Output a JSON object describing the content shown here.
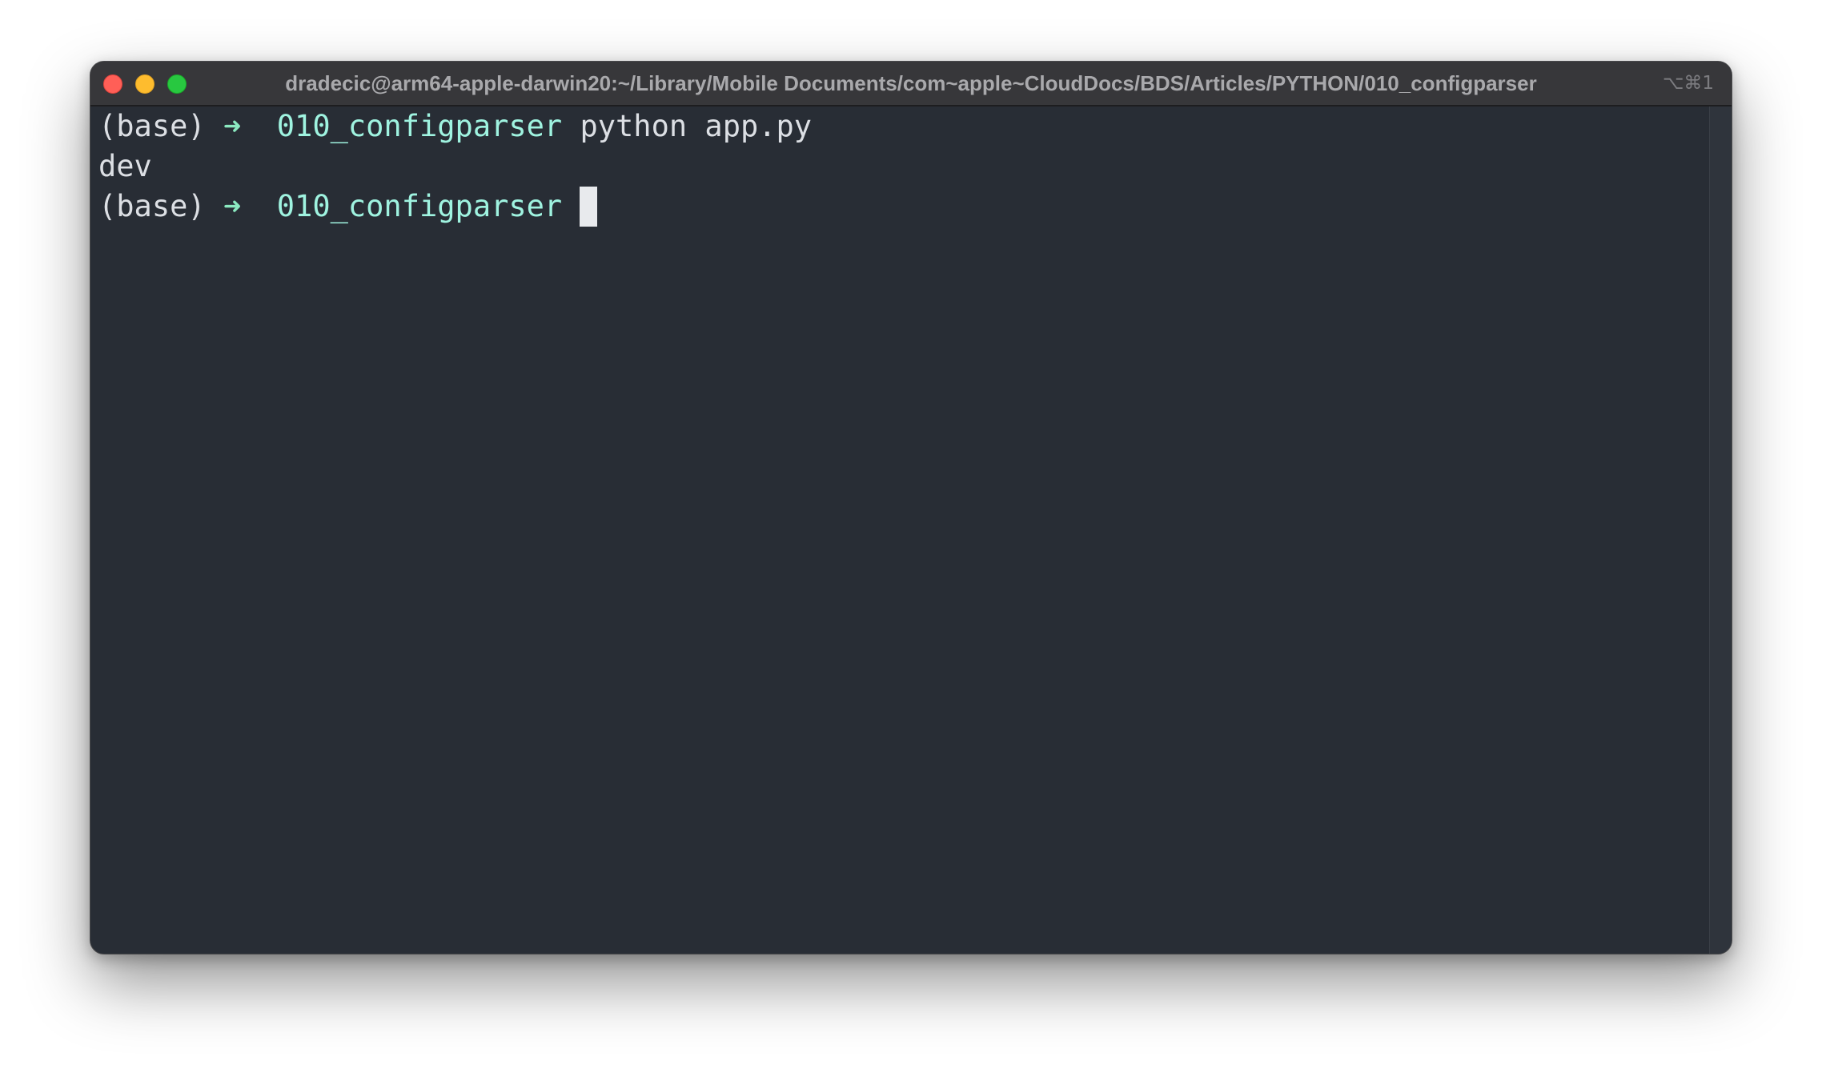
{
  "window": {
    "title": "dradecic@arm64-apple-darwin20:~/Library/Mobile Documents/com~apple~CloudDocs/BDS/Articles/PYTHON/010_configparser",
    "shortcut": "⌥⌘1"
  },
  "terminal": {
    "lines": [
      {
        "env": "(base)",
        "arrow": "➜",
        "dir": "010_configparser",
        "command": "python app.py"
      },
      {
        "output": "dev"
      },
      {
        "env": "(base)",
        "arrow": "➜",
        "dir": "010_configparser",
        "command": ""
      }
    ]
  },
  "colors": {
    "background": "#282d35",
    "titlebar": "#37373a",
    "text": "#dcdfe4",
    "prompt_arrow": "#8be9c0",
    "prompt_dir": "#9ff3e0",
    "close": "#ff5f57",
    "minimize": "#febc2e",
    "zoom": "#28c840"
  }
}
